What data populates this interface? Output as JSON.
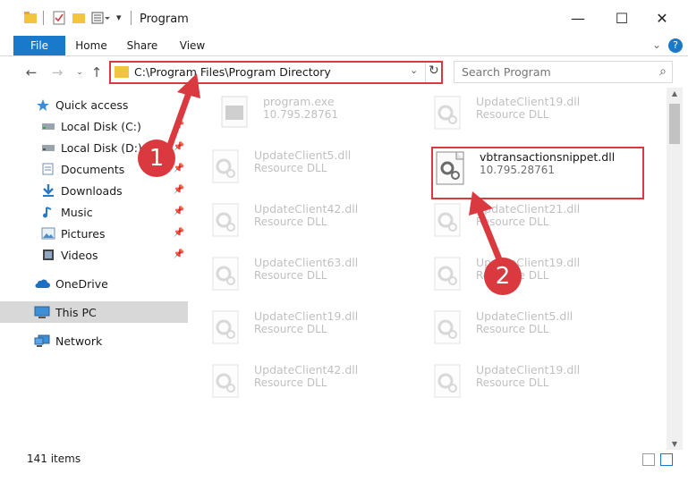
{
  "window": {
    "title": "Program",
    "controls": {
      "minimize": "—",
      "maximize": "☐",
      "close": "✕"
    }
  },
  "ribbon": {
    "tabs": [
      {
        "label": "File"
      },
      {
        "label": "Home"
      },
      {
        "label": "Share"
      },
      {
        "label": "View"
      }
    ],
    "help": "?"
  },
  "address": {
    "path": "C:\\Program Files\\Program Directory",
    "search_placeholder": "Search Program"
  },
  "sidebar": {
    "items": [
      {
        "label": "Quick access",
        "icon": "star-icon",
        "pinned": false
      },
      {
        "label": "Local Disk (C:)",
        "icon": "drive-icon",
        "pinned": true
      },
      {
        "label": "Local Disk (D:)",
        "icon": "drive-icon",
        "pinned": true
      },
      {
        "label": "Documents",
        "icon": "documents-icon",
        "pinned": true
      },
      {
        "label": "Downloads",
        "icon": "download-icon",
        "pinned": true
      },
      {
        "label": "Music",
        "icon": "music-icon",
        "pinned": true
      },
      {
        "label": "Pictures",
        "icon": "pictures-icon",
        "pinned": true
      },
      {
        "label": "Videos",
        "icon": "videos-icon",
        "pinned": true
      },
      {
        "label": "OneDrive",
        "icon": "cloud-icon",
        "pinned": false
      },
      {
        "label": "This PC",
        "icon": "computer-icon",
        "pinned": false,
        "selected": true
      },
      {
        "label": "Network",
        "icon": "network-icon",
        "pinned": false
      }
    ]
  },
  "files": {
    "left_column": [
      {
        "name": "program.exe",
        "type": "10.795.28761"
      },
      {
        "name": "UpdateClient5.dll",
        "type": "Resource DLL"
      },
      {
        "name": "UpdateClient42.dll",
        "type": "Resource DLL"
      },
      {
        "name": "UpdateClient63.dll",
        "type": "Resource DLL"
      },
      {
        "name": "UpdateClient19.dll",
        "type": "Resource DLL"
      },
      {
        "name": "UpdateClient42.dll",
        "type": "Resource DLL"
      }
    ],
    "right_column": [
      {
        "name": "UpdateClient19.dll",
        "type": "Resource DLL"
      },
      {
        "name": "vbtransactionsnippet.dll",
        "type": "10.795.28761",
        "highlighted": true
      },
      {
        "name": "UpdateClient21.dll",
        "type": "Resource DLL"
      },
      {
        "name": "UpdateClient19.dll",
        "type": "Resource DLL"
      },
      {
        "name": "UpdateClient5.dll",
        "type": "Resource DLL"
      },
      {
        "name": "UpdateClient19.dll",
        "type": "Resource DLL"
      }
    ]
  },
  "status": {
    "item_count": "141 items"
  },
  "annotations": {
    "marker1": "1",
    "marker2": "2",
    "accent": "#d9393f"
  }
}
